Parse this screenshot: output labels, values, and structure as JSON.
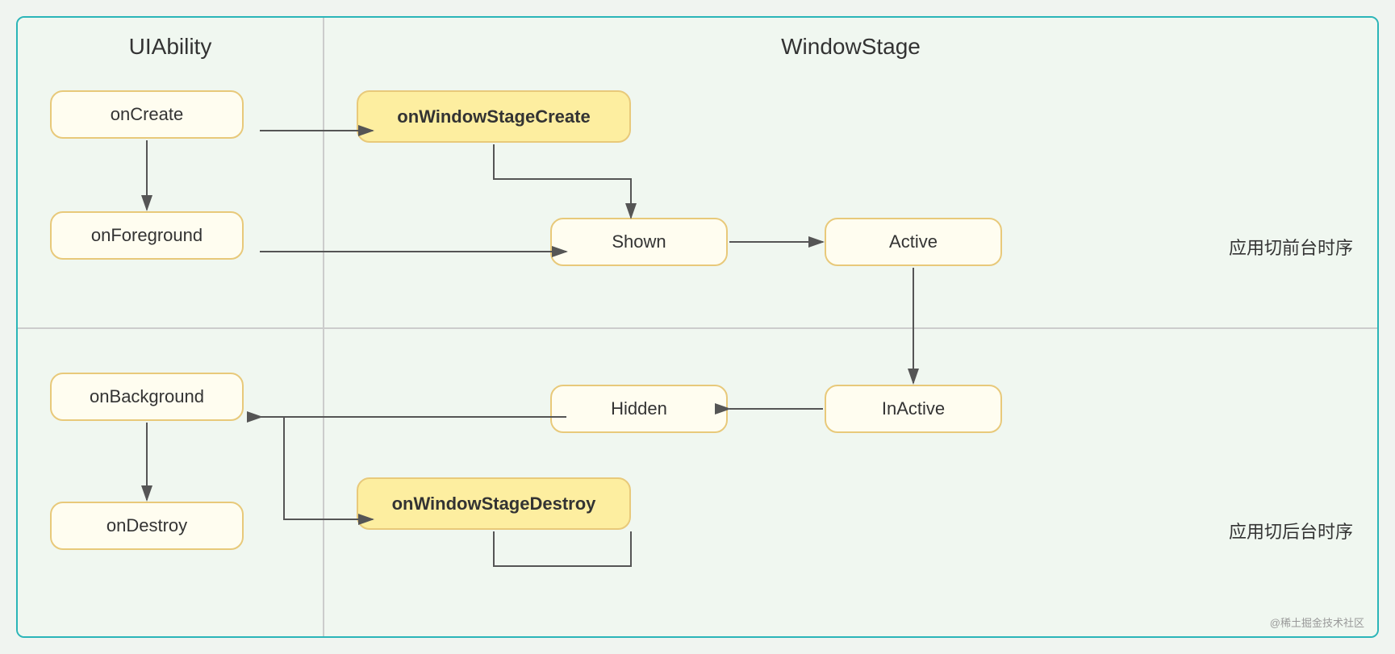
{
  "uiability": {
    "title": "UIAbility",
    "nodes": {
      "onCreate": "onCreate",
      "onForeground": "onForeground",
      "onBackground": "onBackground",
      "onDestroy": "onDestroy"
    }
  },
  "windowstage": {
    "title": "WindowStage",
    "nodes": {
      "onWindowStageCreate": "onWindowStageCreate",
      "onWindowStageDestroy": "onWindowStageDestroy",
      "shown": "Shown",
      "active": "Active",
      "hidden": "Hidden",
      "inactive": "InActive"
    },
    "labels": {
      "front": "应用切前台时序",
      "back": "应用切后台时序"
    }
  },
  "watermark": "@稀土掘金技术社区"
}
